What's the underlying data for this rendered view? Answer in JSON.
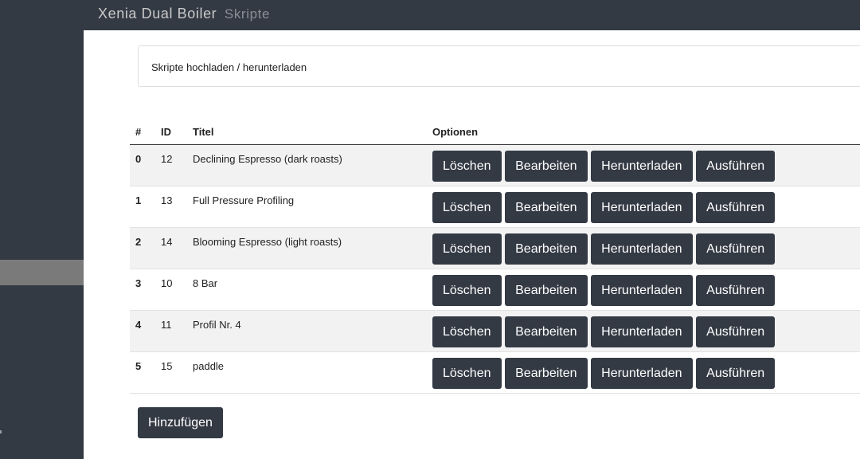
{
  "brand": {
    "title": "Xenia Dual Boiler",
    "subtitle": "Skripte"
  },
  "panel": {
    "text": "Skripte hochladen / herunterladen"
  },
  "table": {
    "headers": {
      "index": "#",
      "id": "ID",
      "title": "Titel",
      "options": "Optionen"
    },
    "rows": [
      {
        "index": "0",
        "id": "12",
        "title": "Declining Espresso (dark roasts)"
      },
      {
        "index": "1",
        "id": "13",
        "title": "Full Pressure Profiling"
      },
      {
        "index": "2",
        "id": "14",
        "title": "Blooming Espresso (light roasts)"
      },
      {
        "index": "3",
        "id": "10",
        "title": "8 Bar"
      },
      {
        "index": "4",
        "id": "11",
        "title": "Profil Nr. 4"
      },
      {
        "index": "5",
        "id": "15",
        "title": "paddle"
      }
    ]
  },
  "actions": {
    "delete": "Löschen",
    "edit": "Bearbeiten",
    "download": "Herunterladen",
    "run": "Ausführen"
  },
  "add_label": "Hinzufügen",
  "colors": {
    "dark": "#343a44",
    "sidebar_active": "#7a7a7a",
    "row_alt": "#f2f2f2"
  }
}
